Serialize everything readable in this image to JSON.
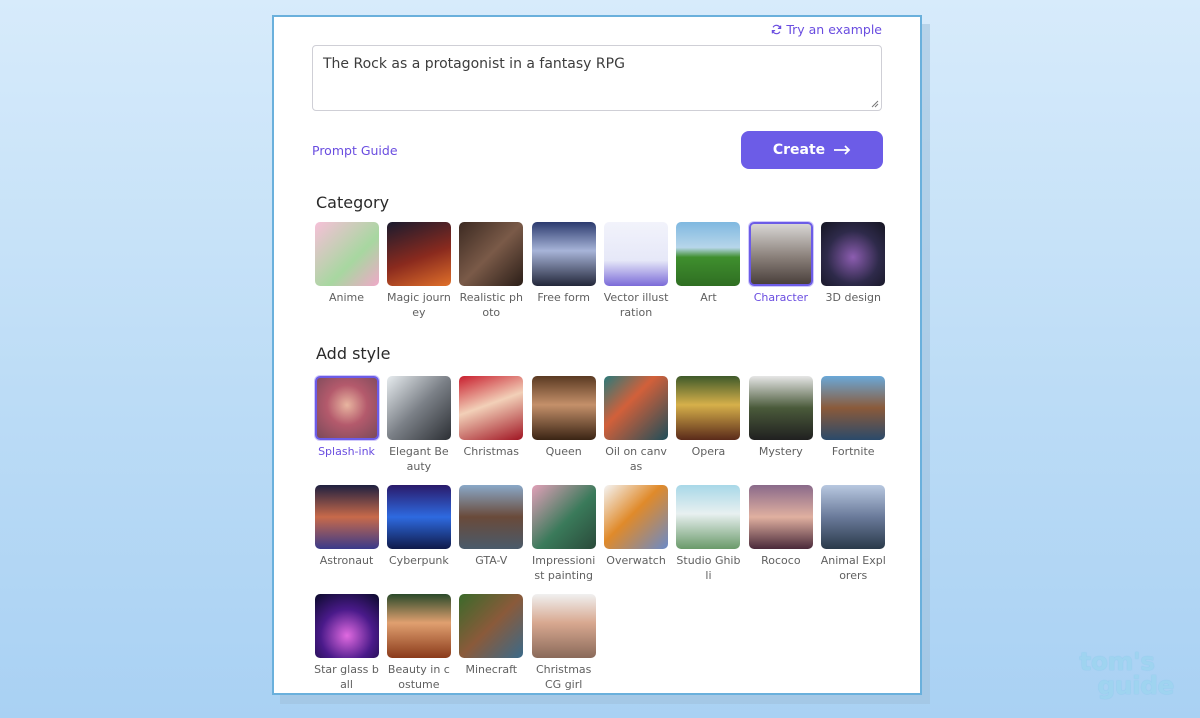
{
  "header": {
    "try_example": "Try an example"
  },
  "prompt": {
    "value": "The Rock as a protagonist in a fantasy RPG"
  },
  "actions": {
    "prompt_guide": "Prompt Guide",
    "create": "Create"
  },
  "category": {
    "title": "Category",
    "selected": "Character",
    "items": [
      {
        "label": "Anime",
        "bg": "linear-gradient(135deg,#f6c0d8,#a7d7a0 60%,#f0a8c8)"
      },
      {
        "label": "Magic journey",
        "bg": "linear-gradient(160deg,#1a1b2e,#8a2a1e 55%,#e0702a)"
      },
      {
        "label": "Realistic photo",
        "bg": "linear-gradient(135deg,#3c2a22,#7a5a48 50%,#2b1e18)"
      },
      {
        "label": "Free form",
        "bg": "linear-gradient(180deg,#2b3a6e,#a7b4d8 45%,#23273a)"
      },
      {
        "label": "Vector illustration",
        "bg": "linear-gradient(180deg,#f2f3fb,#e6e8f8 60%,#7b6bd8)"
      },
      {
        "label": "Art",
        "bg": "linear-gradient(180deg,#7fb8e0 0%,#b7d6ea 40%,#3f8f2e 55%,#2f6e22)"
      },
      {
        "label": "Character",
        "bg": "linear-gradient(180deg,#d8d6d4,#8a807a 55%,#4a403c)"
      },
      {
        "label": "3D design",
        "bg": "radial-gradient(circle at 50% 55%,#8c5db0,#2e2a4a 55%,#151522)"
      }
    ]
  },
  "style": {
    "title": "Add style",
    "selected": "Splash-ink",
    "items": [
      {
        "label": "Splash-ink",
        "bg": "radial-gradient(circle at 50% 45%,#e8b5a0,#b45a6c 45%,#7a4a5a)"
      },
      {
        "label": "Elegant Beauty",
        "bg": "linear-gradient(135deg,#e7ecef,#7a7f86 50%,#2c2f34)"
      },
      {
        "label": "Christmas",
        "bg": "linear-gradient(160deg,#c81e2e,#f2d0b8 45%,#a01422)"
      },
      {
        "label": "Queen",
        "bg": "linear-gradient(180deg,#5a3a22,#c4906a 45%,#3a2414)"
      },
      {
        "label": "Oil on canvas",
        "bg": "linear-gradient(135deg,#2a7a7a,#d2603a 40%,#1e4e5a)"
      },
      {
        "label": "Opera",
        "bg": "linear-gradient(180deg,#3e5a2a,#d6b04a 45%,#5a2a1a)"
      },
      {
        "label": "Mystery",
        "bg": "linear-gradient(180deg,#e6e6e6,#4a5a3a 50%,#202020)"
      },
      {
        "label": "Fortnite",
        "bg": "linear-gradient(180deg,#6aa8d8,#8a5a3a 50%,#2a4a6a)"
      },
      {
        "label": "Astronaut",
        "bg": "linear-gradient(180deg,#1e2040,#c86a4a 50%,#3a3a8a)"
      },
      {
        "label": "Cyberpunk",
        "bg": "linear-gradient(180deg,#2a1a6a,#2e6ae0 50%,#101a4a)"
      },
      {
        "label": "GTA-V",
        "bg": "linear-gradient(180deg,#8aa8c8,#6a4a3a 50%,#4a5a6a)"
      },
      {
        "label": "Impressionist painting",
        "bg": "linear-gradient(135deg,#e2a0b8,#3a7a5a 55%,#2a4a3a)"
      },
      {
        "label": "Overwatch",
        "bg": "linear-gradient(135deg,#f4f4f4,#e08a2a 45%,#6a8ac8)"
      },
      {
        "label": "Studio Ghibli",
        "bg": "linear-gradient(180deg,#a8d8e8,#e8f0f0 45%,#6a9a6a)"
      },
      {
        "label": "Rococo",
        "bg": "linear-gradient(180deg,#8a6a8a,#e0b0a0 50%,#4a2a3a)"
      },
      {
        "label": "Animal Explorers",
        "bg": "linear-gradient(180deg,#b8c8e0,#6a7a9a 50%,#2a3a4a)"
      },
      {
        "label": "Star glass ball",
        "bg": "radial-gradient(circle at 50% 65%,#e06ae0,#4a1a8a 50%,#0a0a2a)"
      },
      {
        "label": "Beauty in costume",
        "bg": "linear-gradient(180deg,#2a4a2a,#e0a070 45%,#8a3a1a)"
      },
      {
        "label": "Minecraft",
        "bg": "linear-gradient(135deg,#3a6a2a,#8a5a3a 50%,#3a6a8a)"
      },
      {
        "label": "Christmas CG girl",
        "bg": "linear-gradient(180deg,#f0f0f0,#d8a890 45%,#8a6a5a)"
      }
    ]
  },
  "watermark": {
    "line1": "tom's",
    "line2": "guide"
  },
  "colors": {
    "accent": "#6c5ce7",
    "link": "#6a4de0",
    "card_border": "#6ab0dc"
  }
}
